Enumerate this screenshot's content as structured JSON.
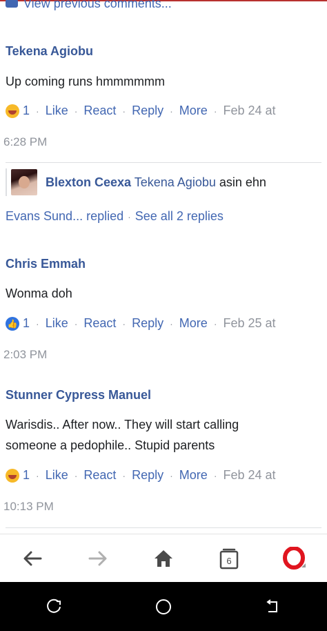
{
  "header": {
    "view_previous": "View previous comments..."
  },
  "comments": [
    {
      "author": "Tekena Agiobu",
      "text": "Up coming runs hmmmmmm",
      "reaction_icon": "haha-emoji-icon",
      "reaction_count": "1",
      "like": "Like",
      "react": "React",
      "reply": "Reply",
      "more": "More",
      "date": "Feb 24 at",
      "time": "6:28 PM"
    },
    {
      "author": "Chris Emmah",
      "text": "Wonma doh",
      "reaction_icon": "like-thumb-icon",
      "reaction_count": "1",
      "like": "Like",
      "react": "React",
      "reply": "Reply",
      "more": "More",
      "date": "Feb 25 at",
      "time": "2:03 PM"
    },
    {
      "author": "Stunner Cypress Manuel",
      "text_line1": "Warisdis.. After now.. They will start calling",
      "text_line2": "someone a pedophile.. Stupid parents",
      "reaction_icon": "haha-emoji-icon",
      "reaction_count": "1",
      "like": "Like",
      "react": "React",
      "reply": "Reply",
      "more": "More",
      "date": "Feb 24 at",
      "time": "10:13 PM"
    }
  ],
  "reply_preview": {
    "author": "Blexton Ceexa",
    "tagged": "Tekena Agiobu",
    "text": "asin ehn"
  },
  "replies_summary": {
    "replied": "Evans Sund... replied",
    "see_all": "See all 2 replies"
  },
  "browser_bar": {
    "tab_count": "6",
    "icons": [
      "back-arrow-icon",
      "forward-arrow-icon",
      "home-icon",
      "tabs-icon",
      "opera-menu-icon"
    ]
  },
  "colors": {
    "link": "#4267b2",
    "author": "#385898",
    "muted": "#90949c",
    "opera_red": "#e0151f"
  }
}
